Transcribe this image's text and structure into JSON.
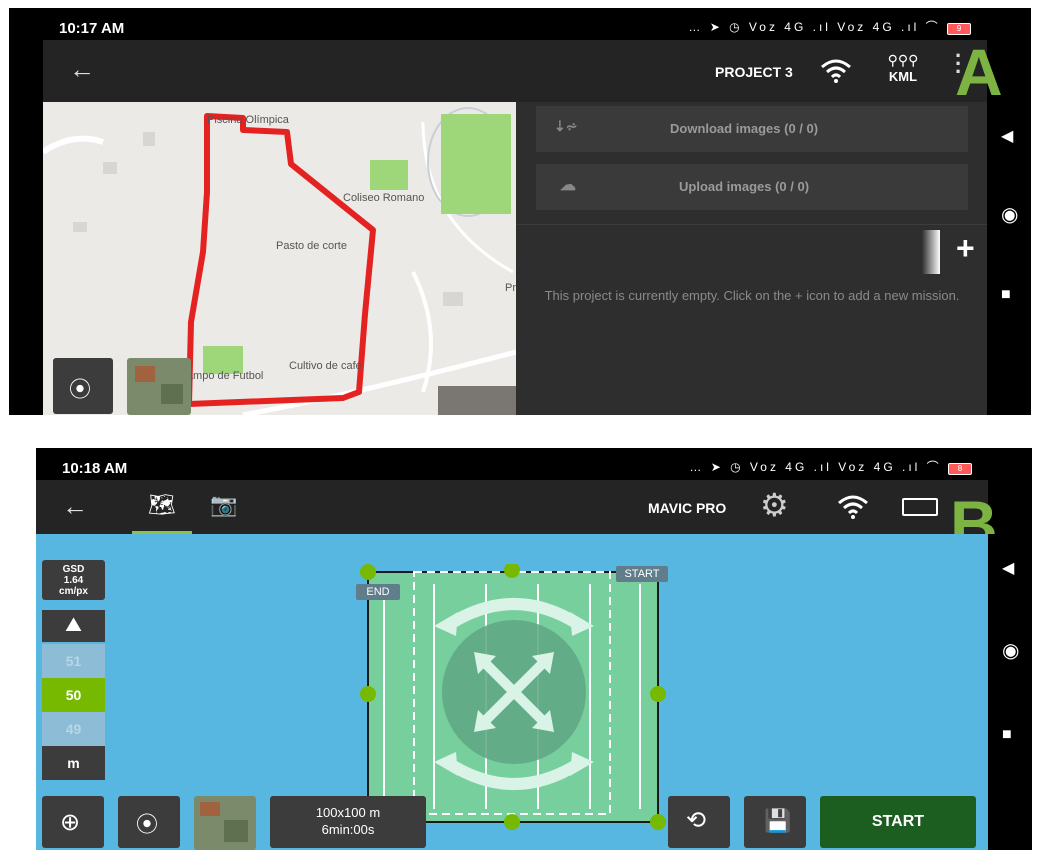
{
  "screen_a": {
    "status": {
      "time": "10:17 AM",
      "icons": "… ➤ ◷ Voz 4G .ıl Voz 4G .ıl ⌒",
      "battery": "9"
    },
    "appbar": {
      "title": "PROJECT 3",
      "kml_label": "KML"
    },
    "map_labels": [
      "Piscina Olímpica",
      "Coliseo Romano",
      "Pasto de corte",
      "Cultivo de café",
      "Campo de Futbol",
      "Pr"
    ],
    "download_label": "Download images (0 / 0)",
    "upload_label": "Upload images (0 / 0)",
    "empty_message": "This project is currently empty. Click on the + icon to add a new mission.",
    "panel_letter": "A"
  },
  "screen_b": {
    "status": {
      "time": "10:18 AM",
      "icons": "… ➤ ◷ Voz 4G .ıl Voz 4G .ıl ⌒",
      "battery": "8"
    },
    "appbar": {
      "title": "MAVIC PRO"
    },
    "gsd": {
      "label": "GSD",
      "value": "1.64",
      "unit": "cm/px"
    },
    "altitude": {
      "above": "51",
      "current": "50",
      "below": "49",
      "unit": "m"
    },
    "flight_info": {
      "area": "100x100 m",
      "duration": "6min:00s"
    },
    "tags": {
      "end": "END",
      "start": "START"
    },
    "start_button": "START",
    "panel_letter": "B"
  }
}
